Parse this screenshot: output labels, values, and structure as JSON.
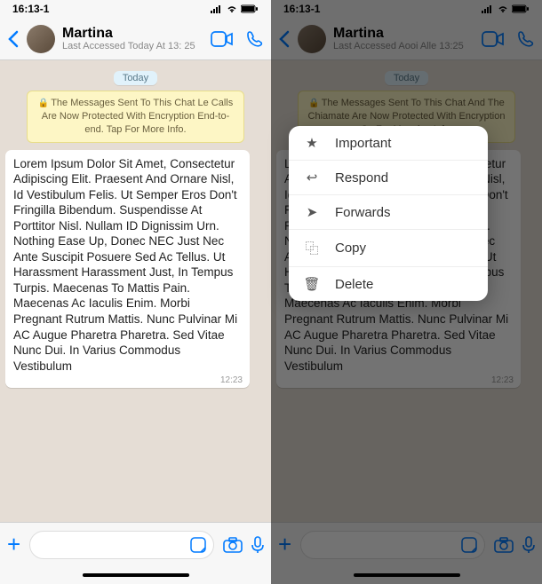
{
  "status": {
    "time": "16:13-1",
    "net": "📶",
    "wifi": "📡",
    "batt": "🔋"
  },
  "header": {
    "name": "Martina",
    "sub_left": "Last Accessed Today At 13: 25",
    "sub_right": "Last Accessed Aooi Alle 13:25",
    "back_icon": "chevron-left",
    "video_icon": "video",
    "call_icon": "phone"
  },
  "chat": {
    "date": "Today",
    "enc_left": "The Messages Sent To This Chat Le Calls Are Now Protected With Encryption End-to-end. Tap For More Info.",
    "enc_right": "The Messages Sent To This Chat And The Chiamate Are Now Protected With Encryption Ca For Maooion Info.",
    "message": "Lorem Ipsum Dolor Sit Amet, Consectetur Adipiscing Elit. Praesent And Ornare Nisl, Id Vestibulum Felis. Ut Semper Eros Don't Fringilla Bibendum. Suspendisse At Porttitor Nisl. Nullam ID Dignissim Urn. Nothing Ease Up, Donec NEC Just Nec Ante Suscipit Posuere Sed Ac Tellus. Ut Harassment Harassment Just, In Tempus Turpis. Maecenas To Mattis Pain. Maecenas Ac Iaculis Enim. Morbi Pregnant Rutrum Mattis. Nunc Pulvinar Mi AC Augue Pharetra Pharetra. Sed Vitae Nunc Dui. In Varius Commodus Vestibulum",
    "message_right": "It Amet, ing Elit. isl, Id Semper Eros im. Titor Nisl. Urn. Nothing This Nec Ante Suscipit Posuere Sed Ac Tellus. Ut Harassment Harassment Just, In Tempus Turpis. Maecenas To Mattis Pain. Maecenas Aciaculis Enim. Morbi Pregnant Rutrum Mattis. Nunc Pulvinar Mi AC Augue Pharetra Pharetra. Sed Vitae Nunc Dui. In Varius Commodus Vestibulum",
    "msg_time": "12:23"
  },
  "menu": {
    "items": [
      {
        "icon": "★",
        "label": "Important"
      },
      {
        "icon": "↩",
        "label": "Respond"
      },
      {
        "icon": "➤",
        "label": "Forwards"
      },
      {
        "icon": "⿻",
        "label": "Copy"
      },
      {
        "icon": "🗑",
        "label": "Delete"
      }
    ]
  },
  "input": {
    "plus_icon": "plus",
    "sticker_icon": "sticker",
    "camera_icon": "camera",
    "mic_icon": "mic"
  }
}
